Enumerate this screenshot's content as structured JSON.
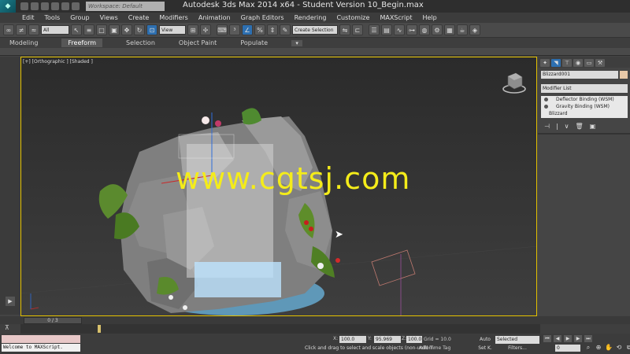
{
  "window": {
    "title": "Autodesk 3ds Max  2014 x64  - Student Version   10_Begin.max",
    "workspace": "Workspace: Default"
  },
  "menu": [
    "Edit",
    "Tools",
    "Group",
    "Views",
    "Create",
    "Modifiers",
    "Animation",
    "Graph Editors",
    "Rendering",
    "Customize",
    "MAXScript",
    "Help"
  ],
  "toolbar": {
    "selection_filter": "All",
    "reference_coord": "View",
    "named_selection": "Create Selection Se"
  },
  "ribbon": {
    "tabs": [
      "Modeling",
      "Freeform",
      "Selection",
      "Object Paint",
      "Populate"
    ],
    "active_tab": "Freeform"
  },
  "viewport": {
    "label": "[+] [Orthographic ] [Shaded ]",
    "watermark": "www.cgtsj.com"
  },
  "command_panel": {
    "object_name": "Blizzard001",
    "object_color": "#e9c9a8",
    "modifier_list_label": "Modifier List",
    "stack": [
      {
        "label": "Deflector Binding (WSM)",
        "type": "wsm"
      },
      {
        "label": "Gravity Binding (WSM)",
        "type": "wsm"
      },
      {
        "label": "Blizzard",
        "type": "base"
      }
    ]
  },
  "timeline": {
    "slider_label": "0 / 3"
  },
  "status": {
    "script_listener": "Welcome to MAXScript.",
    "prompt": "Click and drag to select and scale objects (non-uniforn",
    "x_label": "X:",
    "x_value": "100.0",
    "y_label": "Y:",
    "y_value": "95.969",
    "z_label": "Z:",
    "z_value": "100.0",
    "grid": "Grid = 10.0",
    "add_time_tag": "Add Time Tag",
    "auto_key": "Auto",
    "set_key": "Set K.",
    "key_filter": "Selected",
    "filters": "Filters...",
    "current_frame": "0"
  }
}
